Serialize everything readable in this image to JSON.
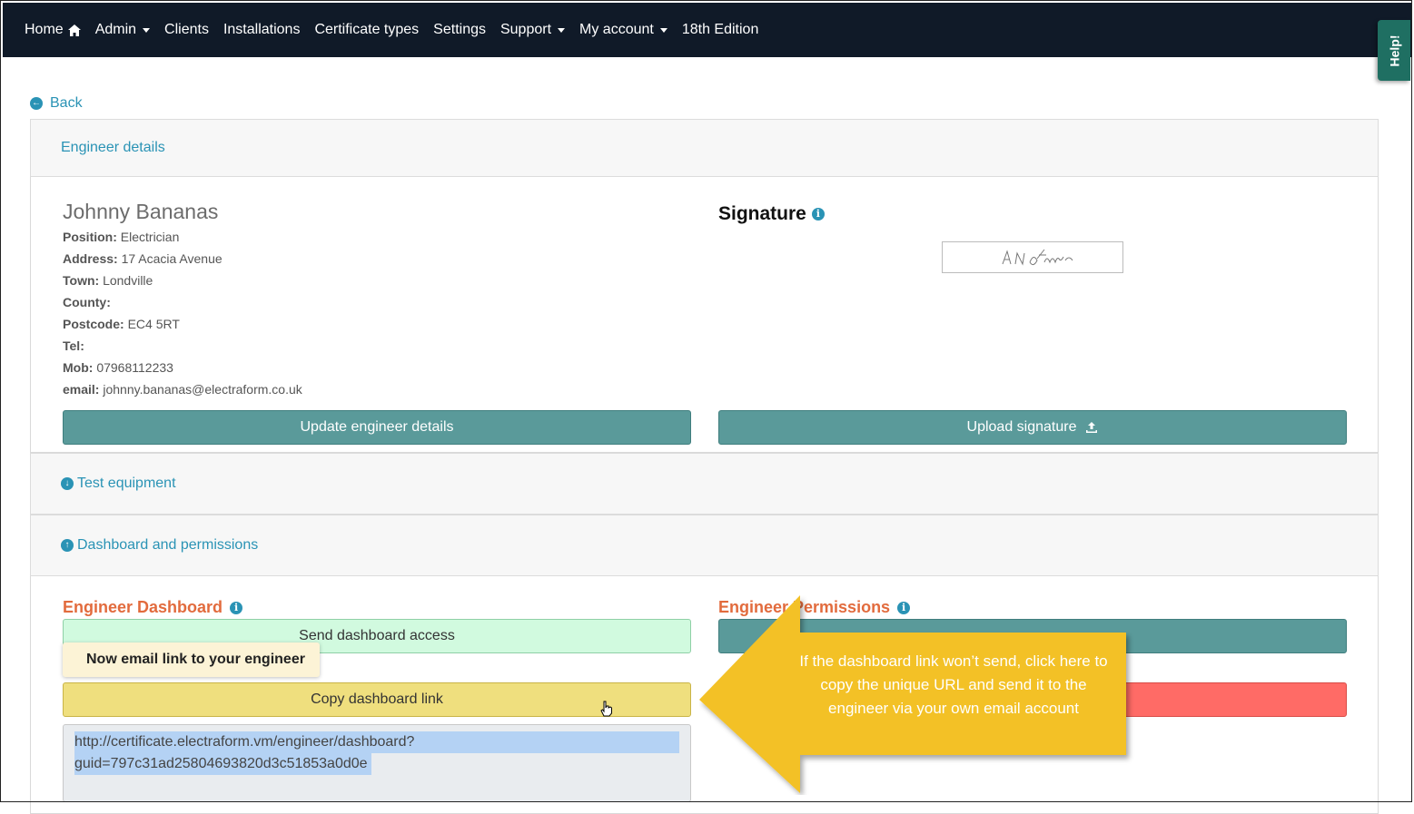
{
  "nav": {
    "items": [
      {
        "label": "Home",
        "icon": "home-icon"
      },
      {
        "label": "Admin",
        "dropdown": true
      },
      {
        "label": "Clients"
      },
      {
        "label": "Installations"
      },
      {
        "label": "Certificate types"
      },
      {
        "label": "Settings"
      },
      {
        "label": "Support",
        "dropdown": true
      },
      {
        "label": "My account",
        "dropdown": true
      },
      {
        "label": "18th Edition"
      }
    ],
    "help_label": "Help!"
  },
  "back_label": "Back",
  "engineer_panel": {
    "heading": "Engineer details",
    "name": "Johnny Bananas",
    "fields": [
      {
        "label": "Position:",
        "value": "Electrician"
      },
      {
        "label": "Address:",
        "value": "17 Acacia Avenue"
      },
      {
        "label": "Town:",
        "value": "Londville"
      },
      {
        "label": "County:",
        "value": ""
      },
      {
        "label": "Postcode:",
        "value": "EC4 5RT"
      },
      {
        "label": "Tel:",
        "value": ""
      },
      {
        "label": "Mob:",
        "value": "07968112233"
      },
      {
        "label": "email:",
        "value": "johnny.bananas@electraform.co.uk"
      }
    ],
    "signature_title": "Signature",
    "signature_text": "A N Other",
    "update_button": "Update engineer details",
    "upload_button": "Upload signature"
  },
  "test_equipment_heading": "Test equipment",
  "dashboard_panel": {
    "heading": "Dashboard and permissions",
    "dashboard_title": "Engineer Dashboard",
    "permissions_title": "Engineer Permissions",
    "send_access_button": "Send dashboard access",
    "copy_link_button": "Copy dashboard link",
    "tooltip": "Now email link to your engineer",
    "url_line1": "http://certificate.electraform.vm/engineer/dashboard?",
    "url_line2": "guid=797c31ad25804693820d3c51853a0d0e"
  },
  "callout_text": "If the dashboard link won’t send, click here to copy the unique URL and send it to the engineer via your own email account",
  "colors": {
    "navbar": "#101a28",
    "accent": "#2a93b5",
    "teal_button": "#5a9a9a",
    "section_title": "#e26b3d",
    "green_button": "#d1fadf",
    "yellow_button": "#efdf7e",
    "red_button": "#ff6b66",
    "callout": "#f3c126"
  }
}
